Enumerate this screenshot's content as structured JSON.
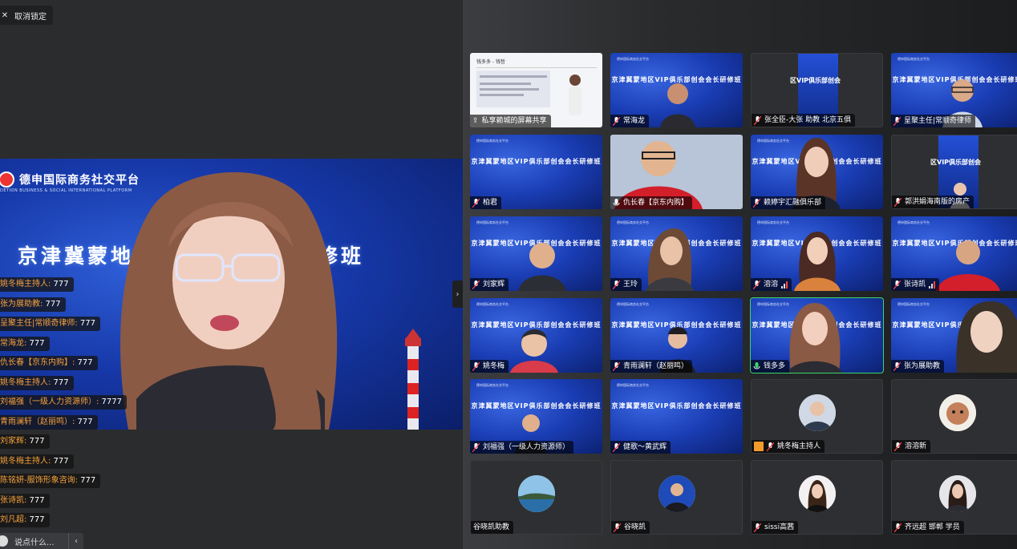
{
  "unlock_button": "取消锁定",
  "main_video": {
    "brand_title": "德申国际商务社交平台",
    "brand_subtitle": "DETION BUSINESS & SOCIAL INTERNATIONAL PLATFORM",
    "banner_left": "京津冀蒙地",
    "banner_right": "创会会长研修班"
  },
  "chat": [
    {
      "name": "姚冬梅主持人:",
      "msg": " 777"
    },
    {
      "name": "张为展助教:",
      "msg": " 777"
    },
    {
      "name": "呈聚主任|常顺奇律师:",
      "msg": " 777"
    },
    {
      "name": "常海龙:",
      "msg": " 777"
    },
    {
      "name": "仇长春【京东内购】:",
      "msg": " 777"
    },
    {
      "name": "姚冬梅主持人:",
      "msg": " 777"
    },
    {
      "name": "刘福强（一级人力资源师）:",
      "msg": " 7777"
    },
    {
      "name": "青雨澜轩（赵丽鸣）:",
      "msg": " 777"
    },
    {
      "name": "刘家辉:",
      "msg": " 777"
    },
    {
      "name": "姚冬梅主持人:",
      "msg": " 777"
    },
    {
      "name": "陈铭妍-服饰形象咨询:",
      "msg": " 777"
    },
    {
      "name": "张诗凯:",
      "msg": " 777"
    },
    {
      "name": "刘凡超:",
      "msg": " 777"
    }
  ],
  "chat_input_placeholder": "说点什么...",
  "collapse_icon": "chevron-right",
  "chat_collapse_icon": "chevron-left",
  "tile_banner": "京津冀蒙地区VIP俱乐部创会会长研修班",
  "tile_banner_cut": "区VIP俱乐部创会",
  "tile_head": "德申国际商务社交平台",
  "share": {
    "title": "钱多多 - 钱哲",
    "label": "私享赖城的屏幕共享"
  },
  "participants": [
    {
      "label": "常海龙"
    },
    {
      "label": "张全臣-大张 助教 北京五俱"
    },
    {
      "label": "呈聚主任|常顺奇律师"
    },
    {
      "label": "柏君"
    },
    {
      "label": "仇长春【京东内购】"
    },
    {
      "label": "赖婷宇汇融俱乐部"
    },
    {
      "label": "郭洪娟海南版的房产"
    },
    {
      "label": "刘家辉"
    },
    {
      "label": "王玲"
    },
    {
      "label": "溶溶"
    },
    {
      "label": "张诗凯"
    },
    {
      "label": "姚冬梅"
    },
    {
      "label": "青雨澜轩（赵丽鸣）"
    },
    {
      "label": "钱多多"
    },
    {
      "label": "张为展助教"
    },
    {
      "label": "刘福强（一级人力资源师）"
    },
    {
      "label": "健歌～黄武辉"
    },
    {
      "label": "姚冬梅主持人"
    },
    {
      "label": "溶溶新"
    },
    {
      "label": "谷晓凯助教"
    },
    {
      "label": "谷晓凯"
    },
    {
      "label": "sissi高茜"
    },
    {
      "label": "齐远超 邯郸 学员"
    }
  ],
  "colors": {
    "accent_active": "#3bd66b",
    "chat_name": "#f7a23a",
    "brand_blue": "#1a3db4"
  }
}
